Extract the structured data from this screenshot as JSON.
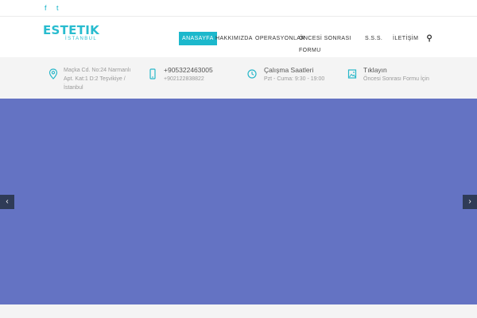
{
  "social": {
    "facebook_glyph": "f",
    "twitter_glyph": "t"
  },
  "logo": {
    "main": "ESTETIK",
    "sub": "İSTANBUL"
  },
  "nav": {
    "items": [
      "ANASAYFA",
      "HAKKIMIZDA",
      "OPERASYONLAR",
      "ÖNCESİ SONRASI",
      "FORMU",
      "S.S.S.",
      "İLETİŞİM"
    ],
    "search_glyph": "⚲"
  },
  "info": {
    "address": [
      "Maçka Cd. No:24 Narmanlı",
      "Apt. Kat:1 D:2 Teşvikiye /",
      "İstanbul"
    ],
    "phones": [
      "+905322463005",
      "+902122838822"
    ],
    "hours_title": "Çalışma Saatleri",
    "hours_text": "Pzt - Cuma: 9:30 - 19:00",
    "form_title": "Tıklayın",
    "form_text": "Öncesi Sonrası Formu İçin"
  },
  "slider": {
    "prev_glyph": "‹",
    "next_glyph": "›"
  },
  "colors": {
    "accent": "#1cb8cc",
    "slider_bg": "#6473c3",
    "arrow_bg": "#2f3b57"
  }
}
